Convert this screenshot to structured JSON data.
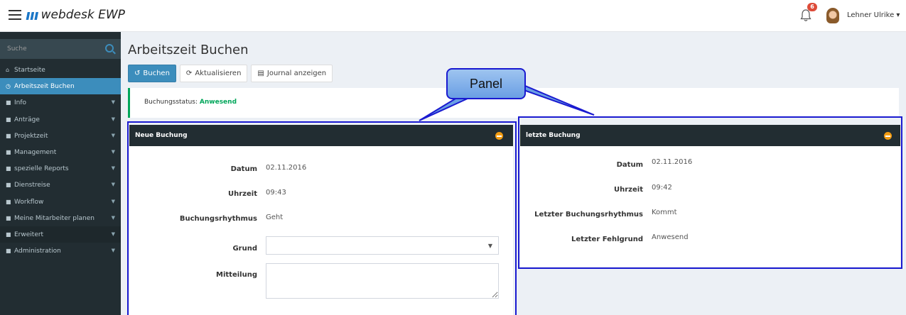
{
  "header": {
    "logo_mark": "ııı",
    "app_title": "webdesk EWP",
    "notification_count": "6",
    "user_name": "Lehner Ulrike ▾"
  },
  "sidebar": {
    "search_placeholder": "Suche",
    "items": [
      {
        "label": "Startseite",
        "icon": "home-icon",
        "glyph": "⌂"
      },
      {
        "label": "Arbeitszeit Buchen",
        "icon": "clock-icon",
        "glyph": "◷"
      },
      {
        "label": "Info",
        "icon": "folder-icon",
        "glyph": "■"
      },
      {
        "label": "Anträge",
        "icon": "folder-icon",
        "glyph": "■"
      },
      {
        "label": "Projektzeit",
        "icon": "folder-icon",
        "glyph": "■"
      },
      {
        "label": "Management",
        "icon": "folder-icon",
        "glyph": "■"
      },
      {
        "label": "spezielle Reports",
        "icon": "folder-icon",
        "glyph": "■"
      },
      {
        "label": "Dienstreise",
        "icon": "folder-icon",
        "glyph": "■"
      },
      {
        "label": "Workflow",
        "icon": "folder-icon",
        "glyph": "■"
      },
      {
        "label": "Meine Mitarbeiter planen",
        "icon": "folder-icon",
        "glyph": "■"
      },
      {
        "label": "Erweitert",
        "icon": "folder-icon",
        "glyph": "■"
      },
      {
        "label": "Administration",
        "icon": "folder-icon",
        "glyph": "■"
      }
    ]
  },
  "page": {
    "title": "Arbeitszeit Buchen",
    "toolbar": {
      "buchen": "Buchen",
      "aktualisieren": "Aktualisieren",
      "journal": "Journal anzeigen"
    },
    "status": {
      "label": "Buchungsstatus:",
      "value": "Anwesend",
      "accent": "#00a65a"
    }
  },
  "panel_new": {
    "title": "Neue Buchung",
    "datum_label": "Datum",
    "datum_value": "02.11.2016",
    "uhrzeit_label": "Uhrzeit",
    "uhrzeit_value": "09:43",
    "rhythmus_label": "Buchungsrhythmus",
    "rhythmus_value": "Geht",
    "grund_label": "Grund",
    "grund_value": "",
    "mitteilung_label": "Mitteilung",
    "mitteilung_value": ""
  },
  "panel_last": {
    "title": "letzte Buchung",
    "datum_label": "Datum",
    "datum_value": "02.11.2016",
    "uhrzeit_label": "Uhrzeit",
    "uhrzeit_value": "09:42",
    "rhythmus_label": "Letzter Buchungsrhythmus",
    "rhythmus_value": "Kommt",
    "fehlgrund_label": "Letzter Fehlgrund",
    "fehlgrund_value": "Anwesend"
  },
  "annotation": {
    "callout_text": "Panel",
    "outline_color": "#1a1ad0"
  }
}
